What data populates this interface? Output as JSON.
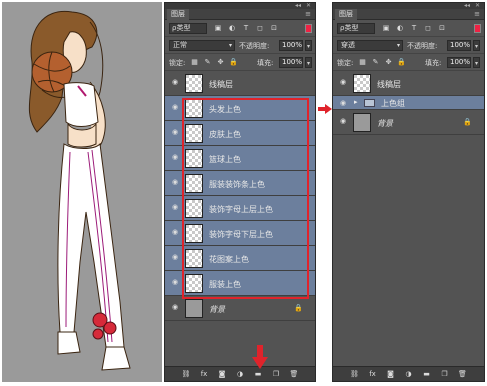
{
  "panel_left": {
    "title": "图层",
    "filter": "ρ类型",
    "blend_mode": "正常",
    "opacity_label": "不透明度:",
    "opacity_value": "100%",
    "lock_label": "锁定:",
    "fill_label": "填充:",
    "fill_value": "100%",
    "layers": [
      {
        "name": "线稿层",
        "selected": false
      },
      {
        "name": "头发上色",
        "selected": true
      },
      {
        "name": "皮肤上色",
        "selected": true
      },
      {
        "name": "篮球上色",
        "selected": true
      },
      {
        "name": "服装装饰条上色",
        "selected": true
      },
      {
        "name": "装饰字母上层上色",
        "selected": true
      },
      {
        "name": "装饰字母下层上色",
        "selected": true
      },
      {
        "name": "花图案上色",
        "selected": true
      },
      {
        "name": "服装上色",
        "selected": true
      }
    ],
    "background_layer": "背景"
  },
  "panel_right": {
    "title": "图层",
    "filter": "ρ类型",
    "blend_mode": "穿透",
    "opacity_label": "不透明度:",
    "opacity_value": "100%",
    "lock_label": "锁定:",
    "fill_label": "填充:",
    "fill_value": "100%",
    "top_layer": "线稿层",
    "group_name": "上色组",
    "background_layer": "背景"
  },
  "icons": {
    "filter": [
      "image-filter-icon",
      "adjustment-filter-icon",
      "type-filter-icon",
      "shape-filter-icon",
      "smart-object-filter-icon"
    ],
    "bottom": [
      "link-icon",
      "fx-icon",
      "mask-icon",
      "adjustment-icon",
      "folder-icon",
      "new-layer-icon",
      "trash-icon"
    ]
  },
  "colors": {
    "panel_bg": "#535353",
    "selection": "#6c7f9d",
    "highlight": "#e0232b"
  }
}
